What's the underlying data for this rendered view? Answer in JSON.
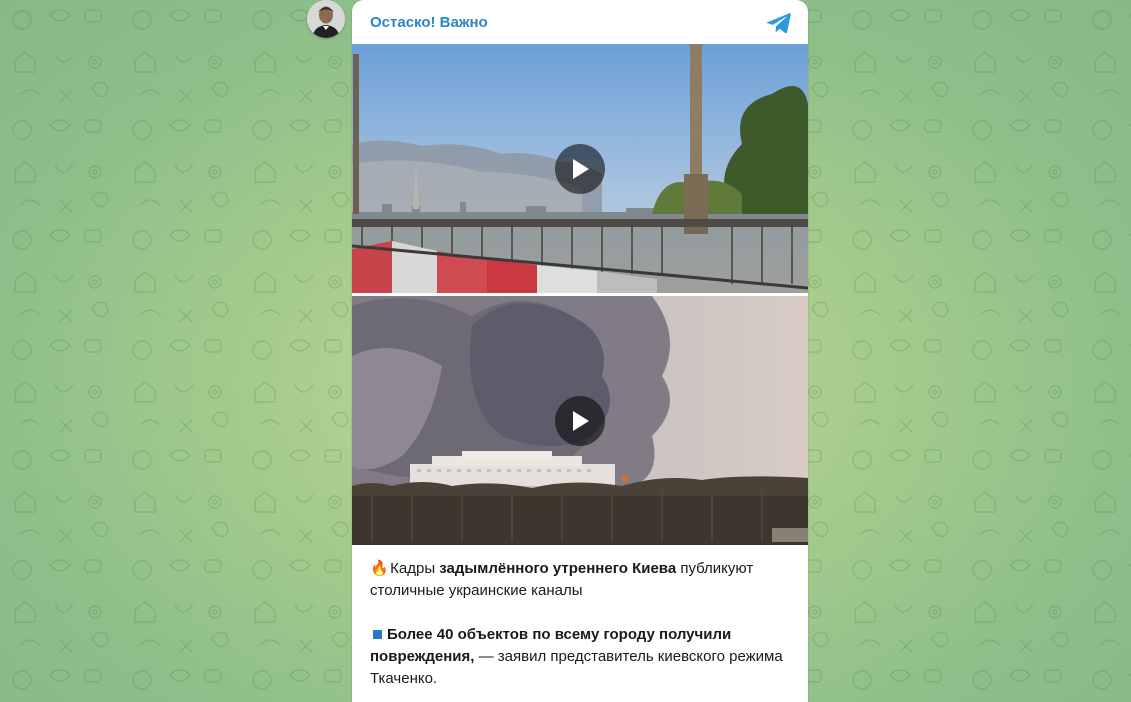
{
  "channel": {
    "name": "Остаско! Важно"
  },
  "videos": [
    {
      "id": "video-1",
      "play_icon": "play-icon"
    },
    {
      "id": "video-2",
      "play_icon": "play-icon"
    }
  ],
  "caption": {
    "p1": {
      "emoji": "🔥",
      "part1": " Кадры ",
      "bold": "задымлённого утреннего Киева",
      "part2": " публикуют столичные украинские каналы"
    },
    "p2": {
      "bold": "Более 40 объектов по всему городу получили повреждения,",
      "rest": " — заявил представитель киевского режима Ткаченко."
    }
  },
  "icons": {
    "telegram": "telegram-plane-icon",
    "avatar": "channel-avatar"
  },
  "colors": {
    "accent": "#2a86c8",
    "background": "#a8cd8d"
  }
}
